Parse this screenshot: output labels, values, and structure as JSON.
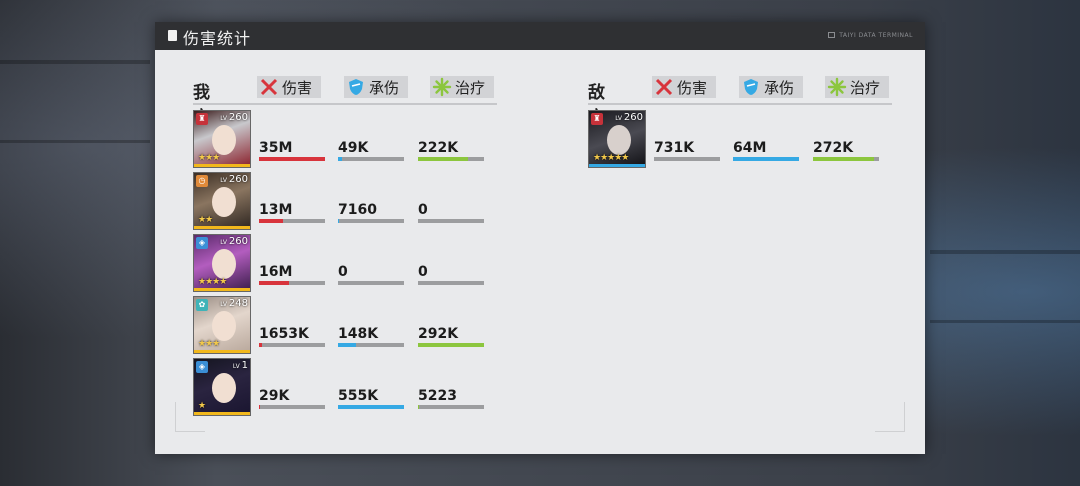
{
  "panel": {
    "title": "伤害统计",
    "brand": "TAIYI DATA TERMINAL"
  },
  "stat_labels": {
    "damage": "伤害",
    "taken": "承伤",
    "healing": "治疗"
  },
  "colors": {
    "damage": "#d8343c",
    "taken": "#35a9e4",
    "healing": "#8cc63e",
    "empty": "#9c9d9f"
  },
  "allies": {
    "label": "我方",
    "units": [
      {
        "level": "260",
        "class": "red-tower",
        "stars": "★★★",
        "damage": "35M",
        "damage_fill": 1.0,
        "taken": "49K",
        "taken_fill": 0.06,
        "healing": "222K",
        "healing_fill": 0.76
      },
      {
        "level": "260",
        "class": "orange-clock",
        "stars": "★★",
        "damage": "13M",
        "damage_fill": 0.37,
        "taken": "7160",
        "taken_fill": 0.01,
        "healing": "0",
        "healing_fill": 0
      },
      {
        "level": "260",
        "class": "blue-shield",
        "stars": "★★★★",
        "damage": "16M",
        "damage_fill": 0.46,
        "taken": "0",
        "taken_fill": 0,
        "healing": "0",
        "healing_fill": 0
      },
      {
        "level": "248",
        "class": "teal-flower",
        "stars": "★★★",
        "damage": "1653K",
        "damage_fill": 0.05,
        "taken": "148K",
        "taken_fill": 0.27,
        "healing": "292K",
        "healing_fill": 1.0
      },
      {
        "level": "1",
        "class": "blue-shield",
        "stars": "★",
        "damage": "29K",
        "damage_fill": 0.01,
        "taken": "555K",
        "taken_fill": 1.0,
        "healing": "5223",
        "healing_fill": 0.02
      }
    ]
  },
  "enemies": {
    "label": "敌方",
    "units": [
      {
        "level": "260",
        "class": "red-tower",
        "stars": "★★★★★",
        "damage": "731K",
        "damage_fill": 0.0,
        "taken": "64M",
        "taken_fill": 1.0,
        "healing": "272K",
        "healing_fill": 0.93
      }
    ]
  },
  "icons": {
    "damage": "crossed-swords-icon",
    "taken": "shield-icon",
    "healing": "sparkle-icon"
  }
}
